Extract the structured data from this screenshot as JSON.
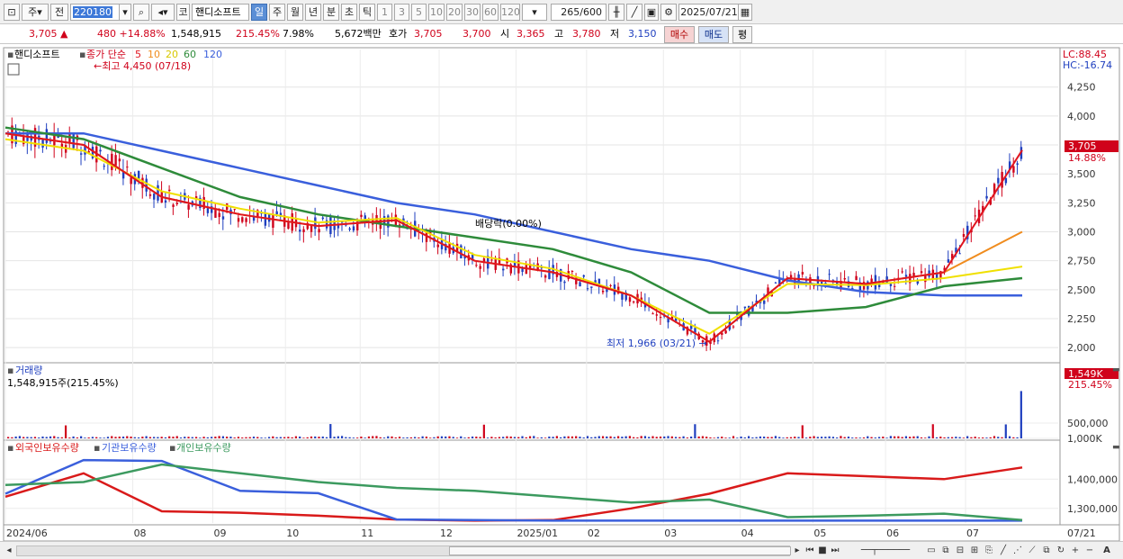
{
  "toolbar": {
    "market_label": "주",
    "prev_label": "전",
    "code": "220180",
    "name_prefix": "코",
    "name": "핸디소프트",
    "periods": [
      "일",
      "주",
      "월",
      "년",
      "분",
      "초",
      "틱"
    ],
    "active_period": "일",
    "intervals": [
      "1",
      "3",
      "5",
      "10",
      "20",
      "30",
      "60",
      "120"
    ],
    "count": "265",
    "count_max": "/600",
    "date": "2025/07/21"
  },
  "quote": {
    "price": "3,705",
    "change_arrow": "▲",
    "change": "480",
    "change_pct": "+14.88%",
    "volume": "1,548,915",
    "volume_ratio": "215.45%",
    "turnover_rate": "7.98%",
    "amount": "5,672백만",
    "bid_label": "호가",
    "bid": "3,705",
    "ask": "3,700",
    "open_label": "시",
    "open": "3,365",
    "high_label": "고",
    "high": "3,780",
    "low_label": "저",
    "low": "3,150",
    "buy_label": "매수",
    "sell_label": "매도",
    "eval_label": "평"
  },
  "price_panel": {
    "stock_label": "핸디소프트",
    "ma_label": "종가 단순",
    "ma_periods": [
      "5",
      "10",
      "20",
      "60",
      "120"
    ],
    "high_marker": "최고 4,450 (07/18)",
    "low_marker": "최저 1,966 (03/21)",
    "dividend_label": "배당락(0.00%)",
    "lc": "LC:88.45",
    "hc": "HC:-16.74",
    "current_price_tag": "3,705",
    "current_pct_tag": "14.88%",
    "y_ticks": [
      "4,250",
      "4,000",
      "3,750",
      "3,500",
      "3,250",
      "3,000",
      "2,750",
      "2,500",
      "2,250",
      "2,000"
    ]
  },
  "volume_panel": {
    "title": "거래량",
    "summary": "1,548,915주(215.45%)",
    "tag_value": "1,549K",
    "tag_pct": "215.45%",
    "y_ticks": [
      "1,000K",
      "500,000"
    ]
  },
  "holdings_panel": {
    "legend": [
      "외국인보유수량",
      "기관보유수량",
      "개인보유수량"
    ],
    "y_ticks": [
      "1,400,000",
      "1,300,000"
    ]
  },
  "x_axis": {
    "labels": [
      "2024/06",
      "08",
      "09",
      "10",
      "11",
      "12",
      "2025/01",
      "02",
      "03",
      "04",
      "05",
      "06",
      "07"
    ],
    "right_label": "07/21"
  },
  "colors": {
    "up": "#d0021b",
    "down": "#1f3fbf",
    "ma5": "#e0141e",
    "ma10": "#f08c1e",
    "ma20": "#f0e000",
    "ma60": "#2e8b3a",
    "ma120": "#3a5fdc",
    "foreign": "#d91a1a",
    "institution": "#3a5fdc",
    "individual": "#3c9a5f"
  },
  "chart_data": {
    "type": "line",
    "title": "핸디소프트",
    "x": [
      "2024/06",
      "08",
      "09",
      "10",
      "11",
      "12",
      "2025/01",
      "02",
      "03",
      "04",
      "05",
      "06",
      "07",
      "07/21"
    ],
    "series": [
      {
        "name": "5",
        "values": [
          3850,
          3750,
          3300,
          3150,
          3050,
          3100,
          2750,
          2650,
          2450,
          2050,
          2600,
          2550,
          2650,
          3705
        ]
      },
      {
        "name": "10",
        "values": [
          3850,
          3750,
          3300,
          3150,
          3050,
          3100,
          2750,
          2650,
          2450,
          2050,
          2600,
          2550,
          2650,
          3000
        ]
      },
      {
        "name": "20",
        "values": [
          3800,
          3700,
          3350,
          3200,
          3080,
          3120,
          2800,
          2680,
          2450,
          2120,
          2550,
          2540,
          2600,
          2700
        ]
      },
      {
        "name": "60",
        "values": [
          3900,
          3800,
          3550,
          3300,
          3150,
          3050,
          2950,
          2850,
          2650,
          2300,
          2300,
          2350,
          2530,
          2600
        ]
      },
      {
        "name": "120",
        "values": [
          3850,
          3850,
          3700,
          3550,
          3400,
          3250,
          3150,
          3000,
          2850,
          2750,
          2580,
          2480,
          2450,
          2450
        ]
      }
    ],
    "ylim": [
      1900,
      4450
    ],
    "high": {
      "value": 4450,
      "date": "07/18"
    },
    "low": {
      "value": 1966,
      "date": "03/21"
    }
  }
}
